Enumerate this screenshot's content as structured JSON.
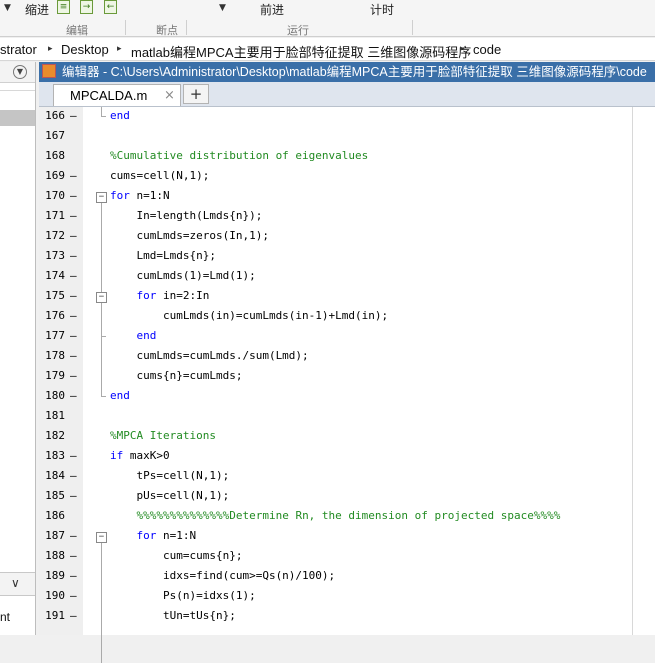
{
  "ribbon": {
    "items": [
      {
        "label": "缩进"
      },
      {
        "label": "前进"
      },
      {
        "label": "计时"
      }
    ],
    "sections": [
      {
        "label": "编辑"
      },
      {
        "label": "断点"
      },
      {
        "label": "运行"
      }
    ],
    "icons": [
      "indent-icon",
      "indent-increase-icon",
      "indent-decrease-icon"
    ]
  },
  "address": {
    "segments": [
      "strator",
      "Desktop",
      "matlab编程MPCA主要用于脸部特征提取 三维图像源码程序",
      "code"
    ]
  },
  "left_panel": {
    "bottom_text": "nt"
  },
  "editor": {
    "title": "编辑器 - C:\\Users\\Administrator\\Desktop\\matlab编程MPCA主要用于脸部特征提取 三维图像源码程序\\code",
    "tab": {
      "label": "MPCALDA.m",
      "close": "×"
    },
    "new_tab": "+",
    "lines": [
      {
        "n": "166",
        "dash": "–",
        "code": [
          {
            "t": "end",
            "c": "kw"
          }
        ]
      },
      {
        "n": "167",
        "dash": "",
        "code": []
      },
      {
        "n": "168",
        "dash": "",
        "code": [
          {
            "t": "%Cumulative distribution of eigenvalues",
            "c": "cm"
          }
        ]
      },
      {
        "n": "169",
        "dash": "–",
        "code": [
          {
            "t": "cums=cell(N,1);",
            "c": ""
          }
        ]
      },
      {
        "n": "170",
        "dash": "–",
        "code": [
          {
            "t": "for",
            "c": "kw"
          },
          {
            "t": " n=1:N",
            "c": ""
          }
        ]
      },
      {
        "n": "171",
        "dash": "–",
        "code": [
          {
            "t": "    In=length(Lmds{n});",
            "c": ""
          }
        ]
      },
      {
        "n": "172",
        "dash": "–",
        "code": [
          {
            "t": "    cumLmds=zeros(In,1);",
            "c": ""
          }
        ]
      },
      {
        "n": "173",
        "dash": "–",
        "code": [
          {
            "t": "    Lmd=Lmds{n};",
            "c": ""
          }
        ]
      },
      {
        "n": "174",
        "dash": "–",
        "code": [
          {
            "t": "    cumLmds(1)=Lmd(1);",
            "c": ""
          }
        ]
      },
      {
        "n": "175",
        "dash": "–",
        "code": [
          {
            "t": "    ",
            "c": ""
          },
          {
            "t": "for",
            "c": "kw"
          },
          {
            "t": " in=2:In",
            "c": ""
          }
        ]
      },
      {
        "n": "176",
        "dash": "–",
        "code": [
          {
            "t": "        cumLmds(in)=cumLmds(in-1)+Lmd(in);",
            "c": ""
          }
        ]
      },
      {
        "n": "177",
        "dash": "–",
        "code": [
          {
            "t": "    ",
            "c": ""
          },
          {
            "t": "end",
            "c": "kw"
          }
        ]
      },
      {
        "n": "178",
        "dash": "–",
        "code": [
          {
            "t": "    cumLmds=cumLmds./sum(Lmd);",
            "c": ""
          }
        ]
      },
      {
        "n": "179",
        "dash": "–",
        "code": [
          {
            "t": "    cums{n}=cumLmds;",
            "c": ""
          }
        ]
      },
      {
        "n": "180",
        "dash": "–",
        "code": [
          {
            "t": "end",
            "c": "kw"
          }
        ]
      },
      {
        "n": "181",
        "dash": "",
        "code": []
      },
      {
        "n": "182",
        "dash": "",
        "code": [
          {
            "t": "%MPCA Iterations",
            "c": "cm"
          }
        ]
      },
      {
        "n": "183",
        "dash": "–",
        "code": [
          {
            "t": "if",
            "c": "kw"
          },
          {
            "t": " maxK>0",
            "c": ""
          }
        ]
      },
      {
        "n": "184",
        "dash": "–",
        "code": [
          {
            "t": "    tPs=cell(N,1);",
            "c": ""
          }
        ]
      },
      {
        "n": "185",
        "dash": "–",
        "code": [
          {
            "t": "    pUs=cell(N,1);",
            "c": ""
          }
        ]
      },
      {
        "n": "186",
        "dash": "",
        "code": [
          {
            "t": "    ",
            "c": ""
          },
          {
            "t": "%%%%%%%%%%%%%%Determine Rn, the dimension of projected space%%%%",
            "c": "cm"
          }
        ]
      },
      {
        "n": "187",
        "dash": "–",
        "code": [
          {
            "t": "    ",
            "c": ""
          },
          {
            "t": "for",
            "c": "kw"
          },
          {
            "t": " n=1:N",
            "c": ""
          }
        ]
      },
      {
        "n": "188",
        "dash": "–",
        "code": [
          {
            "t": "        cum=cums{n};",
            "c": ""
          }
        ]
      },
      {
        "n": "189",
        "dash": "–",
        "code": [
          {
            "t": "        idxs=find(cum>=Qs(n)/100);",
            "c": ""
          }
        ]
      },
      {
        "n": "190",
        "dash": "–",
        "code": [
          {
            "t": "        Ps(n)=idxs(1);",
            "c": ""
          }
        ]
      },
      {
        "n": "191",
        "dash": "–",
        "code": [
          {
            "t": "        tUn=tUs{n};",
            "c": ""
          }
        ]
      }
    ]
  }
}
